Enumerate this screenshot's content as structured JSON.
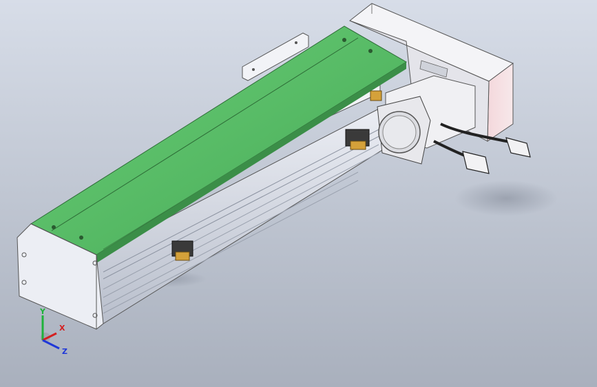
{
  "view": {
    "background_top": "#d7dde8",
    "background_bottom": "#a9b0bd"
  },
  "model": {
    "cover_color": "#5cbf6a",
    "motor_color": "#e8e8ec",
    "frame_color": "#e9ebf2"
  },
  "triad": {
    "x_label": "X",
    "y_label": "Y",
    "z_label": "Z",
    "x_color": "#d42020",
    "y_color": "#1fb23a",
    "z_color": "#2038d8"
  }
}
